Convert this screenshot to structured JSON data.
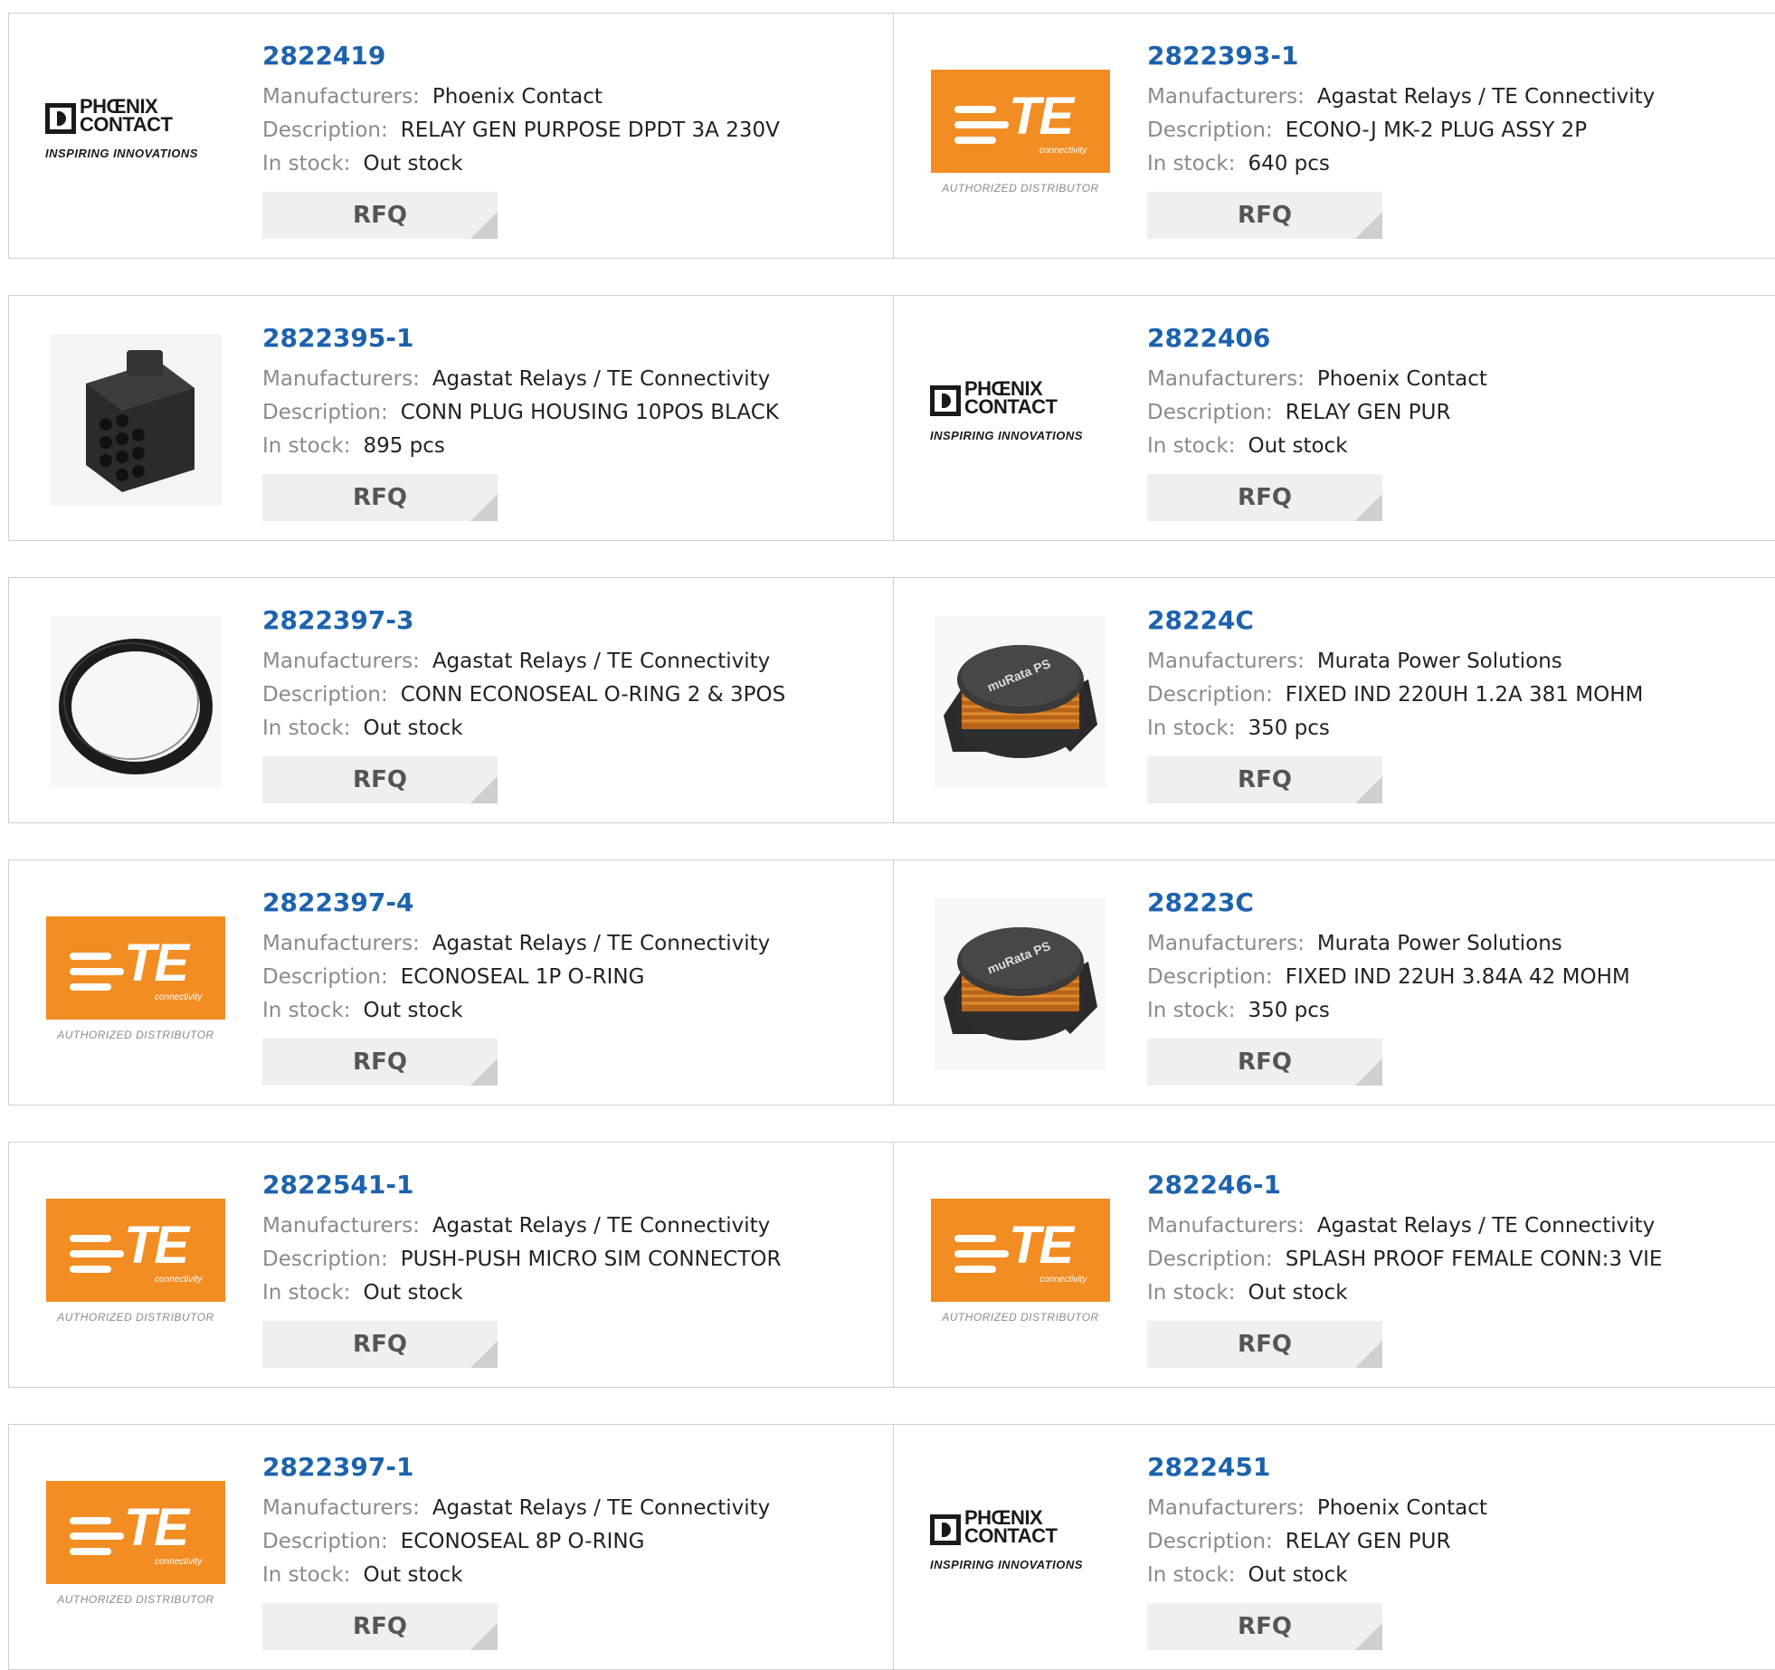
{
  "labels": {
    "manufacturers": "Manufacturers:",
    "description": "Description:",
    "in_stock": "In stock:",
    "rfq": "RFQ"
  },
  "logos": {
    "te": {
      "text": "TE",
      "sub": "connectivity",
      "authorized": "AUTHORIZED DISTRIBUTOR",
      "color": "#f28d23"
    },
    "phoenix": {
      "line1": "PHŒNIX",
      "line2": "CONTACT",
      "tagline": "INSPIRING INNOVATIONS"
    }
  },
  "colors": {
    "part_number": "#1d62ac",
    "label": "#8a8a8a",
    "button_bg": "#efefef"
  },
  "products": [
    {
      "part": "2822419",
      "manufacturer": "Phoenix Contact",
      "description": "RELAY GEN PURPOSE DPDT 3A 230V",
      "stock": "Out stock",
      "image": "phoenix-logo"
    },
    {
      "part": "2822393-1",
      "manufacturer": "Agastat Relays / TE Connectivity",
      "description": "ECONO-J MK-2 PLUG ASSY 2P",
      "stock": "640 pcs",
      "image": "te-logo"
    },
    {
      "part": "2822395-1",
      "manufacturer": "Agastat Relays / TE Connectivity",
      "description": "CONN PLUG HOUSING 10POS BLACK",
      "stock": "895 pcs",
      "image": "connector-photo"
    },
    {
      "part": "2822406",
      "manufacturer": "Phoenix Contact",
      "description": "RELAY GEN PUR",
      "stock": "Out stock",
      "image": "phoenix-logo"
    },
    {
      "part": "2822397-3",
      "manufacturer": "Agastat Relays / TE Connectivity",
      "description": "CONN ECONOSEAL O-RING 2 & 3POS",
      "stock": "Out stock",
      "image": "oring-photo"
    },
    {
      "part": "28224C",
      "manufacturer": "Murata Power Solutions",
      "description": "FIXED IND 220UH 1.2A 381 MOHM",
      "stock": "350 pcs",
      "image": "inductor-photo"
    },
    {
      "part": "2822397-4",
      "manufacturer": "Agastat Relays / TE Connectivity",
      "description": "ECONOSEAL 1P O-RING",
      "stock": "Out stock",
      "image": "te-logo"
    },
    {
      "part": "28223C",
      "manufacturer": "Murata Power Solutions",
      "description": "FIXED IND 22UH 3.84A 42 MOHM",
      "stock": "350 pcs",
      "image": "inductor-photo"
    },
    {
      "part": "2822541-1",
      "manufacturer": "Agastat Relays / TE Connectivity",
      "description": "PUSH-PUSH MICRO SIM CONNECTOR",
      "stock": "Out stock",
      "image": "te-logo"
    },
    {
      "part": "282246-1",
      "manufacturer": "Agastat Relays / TE Connectivity",
      "description": "SPLASH PROOF FEMALE CONN:3 VIE",
      "stock": "Out stock",
      "image": "te-logo"
    },
    {
      "part": "2822397-1",
      "manufacturer": "Agastat Relays / TE Connectivity",
      "description": "ECONOSEAL 8P O-RING",
      "stock": "Out stock",
      "image": "te-logo"
    },
    {
      "part": "2822451",
      "manufacturer": "Phoenix Contact",
      "description": "RELAY GEN PUR",
      "stock": "Out stock",
      "image": "phoenix-logo"
    }
  ]
}
